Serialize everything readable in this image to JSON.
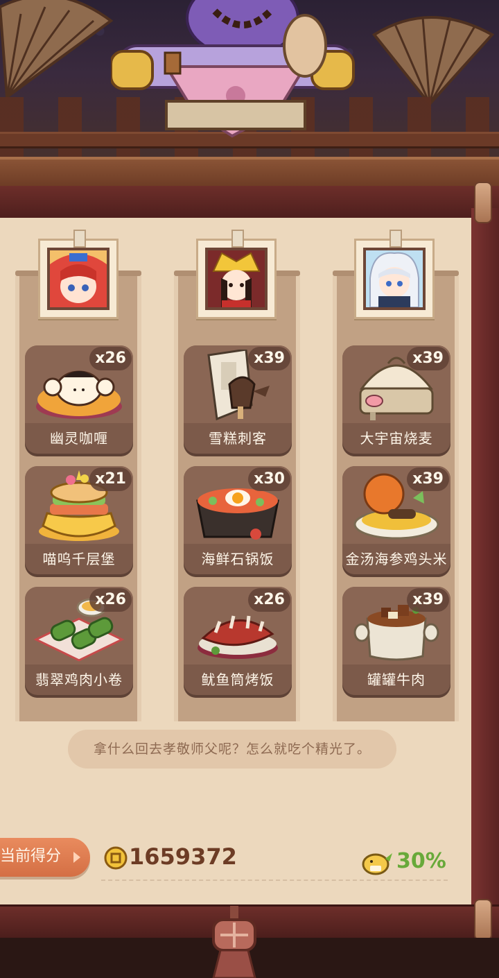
{
  "columns": [
    {
      "portrait": "red-haired-girl-portrait",
      "dishes": [
        {
          "name": "幽灵咖喱",
          "count": "x26"
        },
        {
          "name": "喵呜千层堡",
          "count": "x21"
        },
        {
          "name": "翡翠鸡肉小卷",
          "count": "x26"
        }
      ]
    },
    {
      "portrait": "golden-crown-lady-portrait",
      "dishes": [
        {
          "name": "雪糕刺客",
          "count": "x39"
        },
        {
          "name": "海鲜石锅饭",
          "count": "x30"
        },
        {
          "name": "鱿鱼筒烤饭",
          "count": "x26"
        }
      ]
    },
    {
      "portrait": "white-haired-boy-portrait",
      "dishes": [
        {
          "name": "大宇宙烧麦",
          "count": "x39"
        },
        {
          "name": "金汤海参鸡头米",
          "count": "x39"
        },
        {
          "name": "罐罐牛肉",
          "count": "x39"
        }
      ]
    }
  ],
  "message": "拿什么回去孝敬师父呢？怎么就吃个精光了。",
  "score": {
    "label": "当前得分",
    "value": "1659372",
    "bonus": "30%"
  },
  "colors": {
    "paper": "#ecd8bd",
    "card": "#7c5a4a",
    "scroll": "#6d2e2a",
    "score_tab": "#e27d50",
    "bonus": "#68a93a"
  }
}
